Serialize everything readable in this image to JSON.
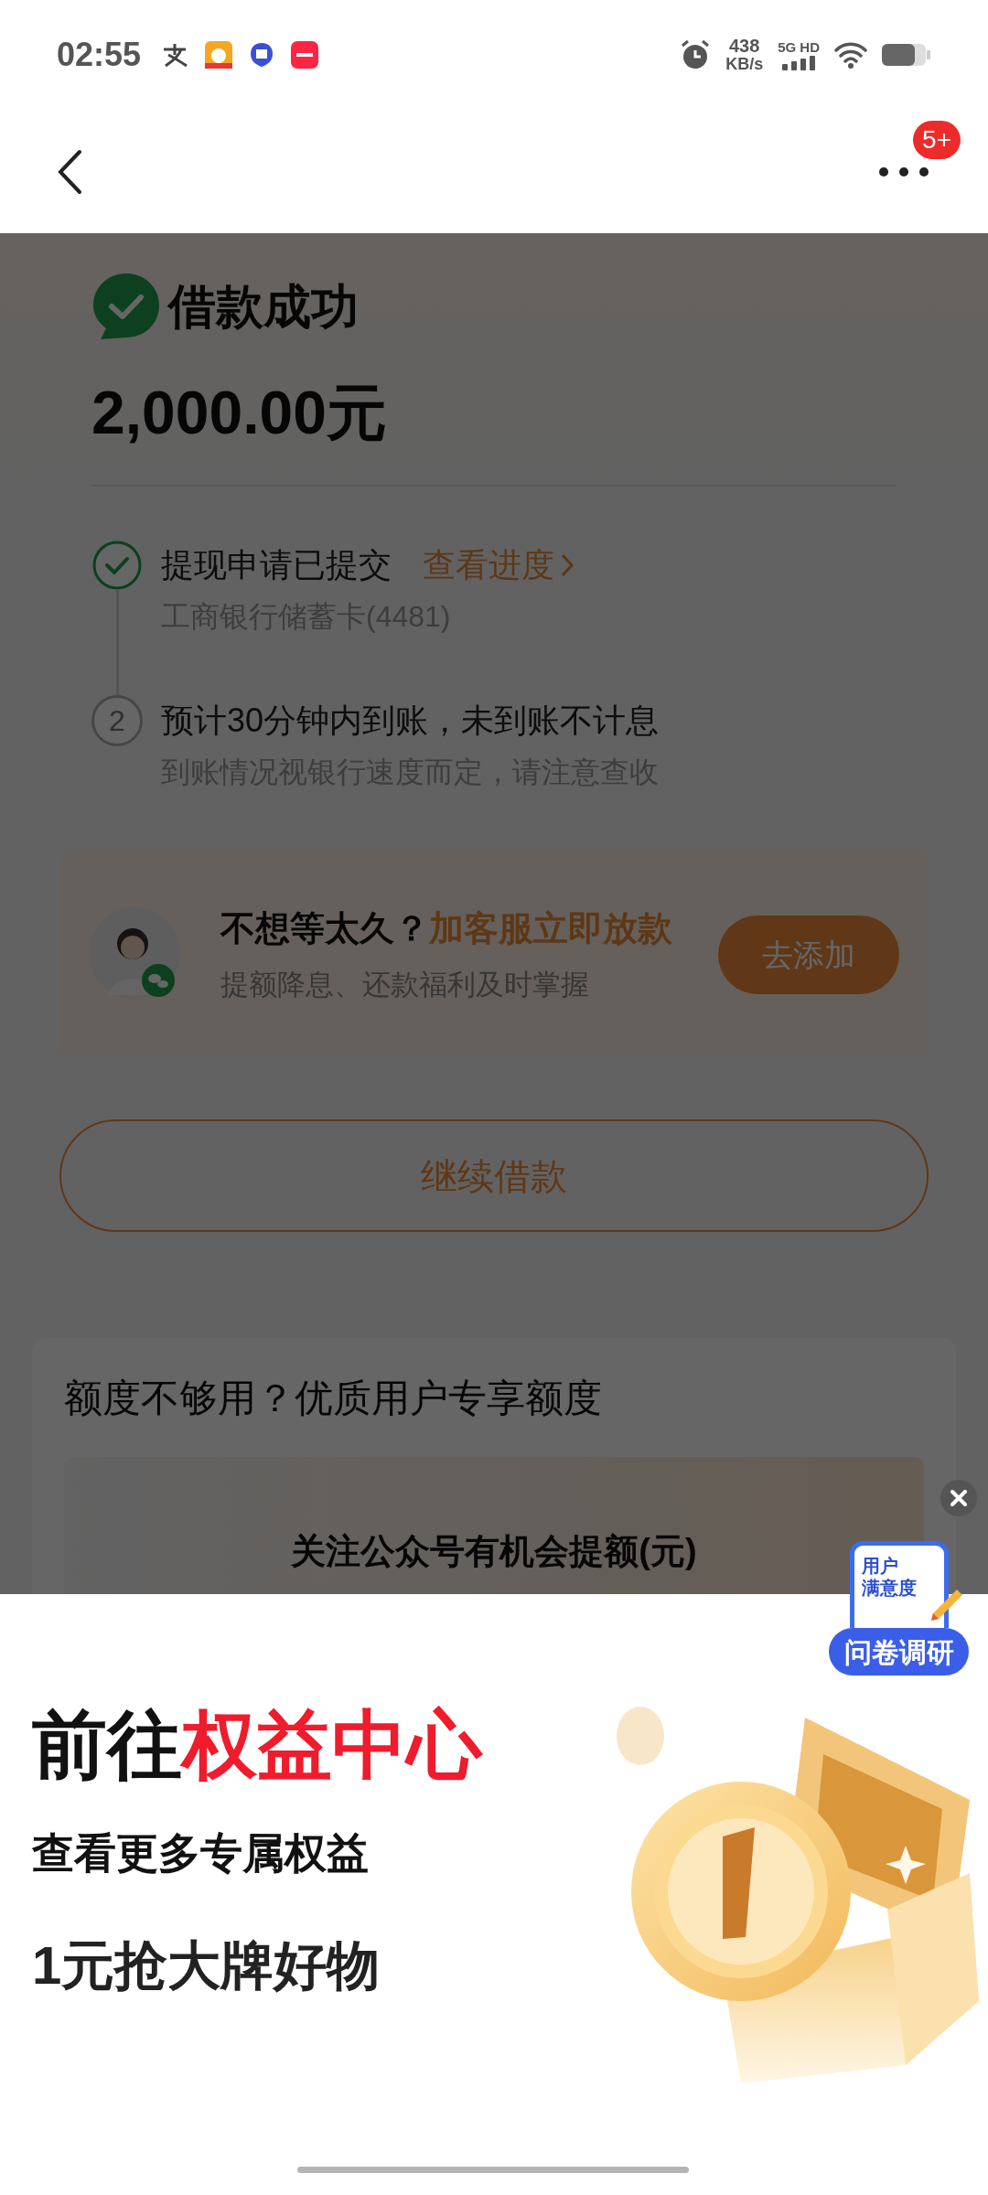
{
  "status_bar": {
    "time": "02:55",
    "net_speed": "438",
    "net_unit": "KB/s",
    "network": "5G HD"
  },
  "nav": {
    "badge": "5+"
  },
  "result": {
    "title": "借款成功",
    "amount": "2,000.00元"
  },
  "steps": [
    {
      "done": true,
      "title": "提现申请已提交",
      "link": "查看进度",
      "subtitle": "工商银行储蓄卡(4481)"
    },
    {
      "done": false,
      "marker": "2",
      "title": "预计30分钟内到账，未到账不计息",
      "subtitle": "到账情况视银行速度而定，请注意查收"
    }
  ],
  "promo_card": {
    "title": "不想等太久？",
    "highlight": "加客服立即放款",
    "subtitle": "提额降息、还款福利及时掌握",
    "button": "去添加"
  },
  "continue_button": "继续借款",
  "quota_card": {
    "title": "额度不够用？优质用户专享额度",
    "banner_title": "关注公众号有机会提额(元)"
  },
  "survey": {
    "icon_lines": [
      "用户",
      "满意度"
    ],
    "button": "问卷调研"
  },
  "sheet": {
    "title": "前往",
    "title_highlight": "权益中心",
    "subtitle": "查看更多专属权益",
    "tagline": "1元抢大牌好物"
  }
}
